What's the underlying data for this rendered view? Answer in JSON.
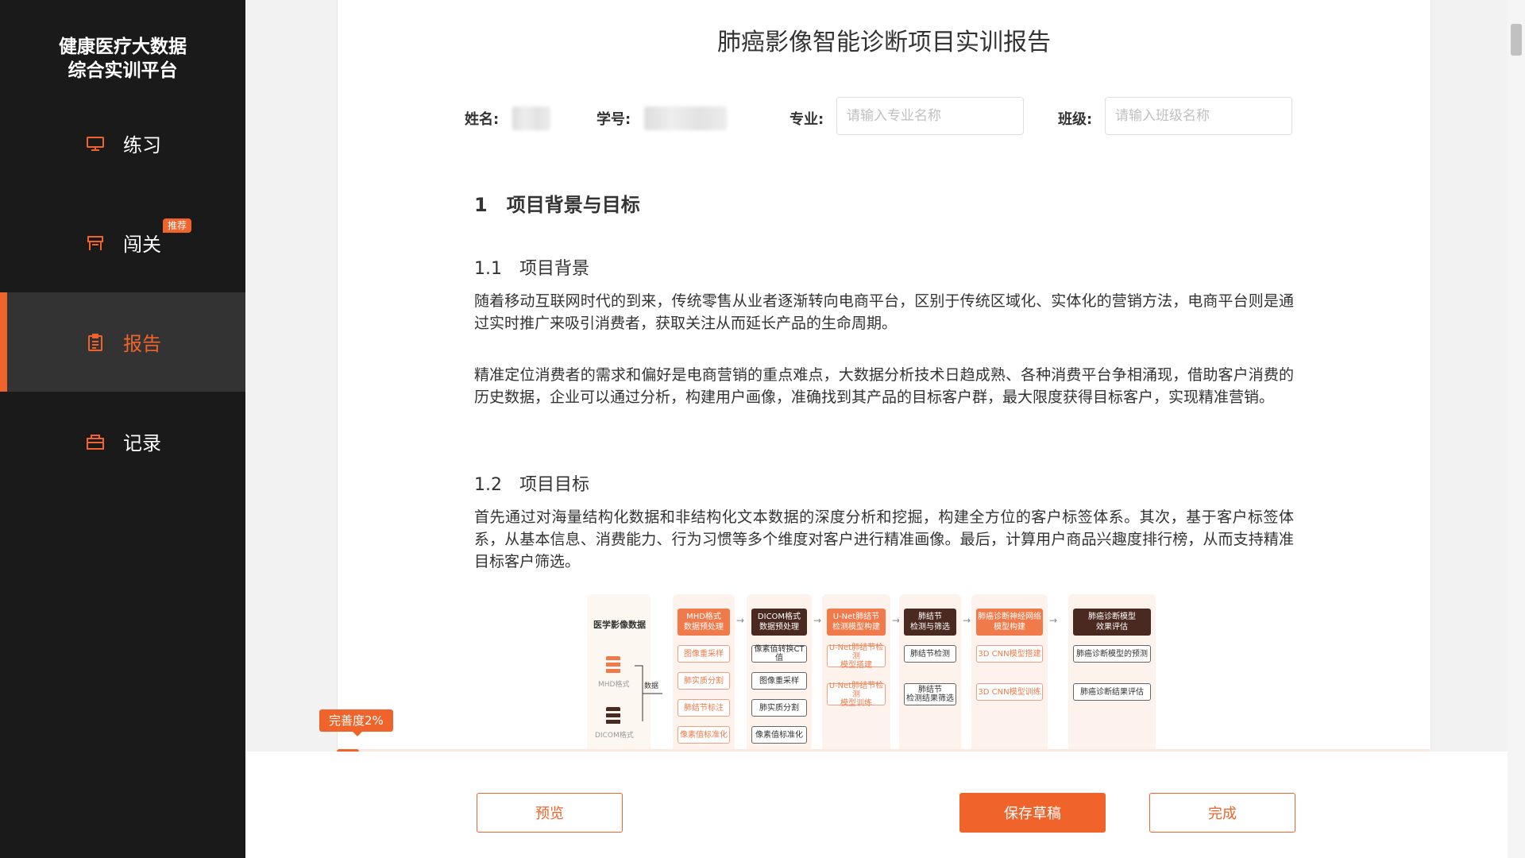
{
  "brand": {
    "line1": "健康医疗大数据",
    "line2": "综合实训平台"
  },
  "nav": [
    {
      "label": "练习",
      "icon": "monitor-icon"
    },
    {
      "label": "闯关",
      "icon": "flag-icon",
      "badge": "推荐"
    },
    {
      "label": "报告",
      "icon": "report-icon",
      "active": true
    },
    {
      "label": "记录",
      "icon": "folder-icon"
    }
  ],
  "document": {
    "title": "肺癌影像智能诊断项目实训报告",
    "fields": {
      "name_label": "姓名:",
      "id_label": "学号:",
      "major_label": "专业:",
      "major_placeholder": "请输入专业名称",
      "class_label": "班级:",
      "class_placeholder": "请输入班级名称"
    },
    "section1": "1　项目背景与目标",
    "section1_1": "1.1　项目背景",
    "para1": "随着移动互联网时代的到来，传统零售从业者逐渐转向电商平台，区别于传统区域化、实体化的营销方法，电商平台则是通过实时推广来吸引消费者，获取关注从而延长产品的生命周期。",
    "para2": "精准定位消费者的需求和偏好是电商营销的重点难点，大数据分析技术日趋成熟、各种消费平台争相涌现，借助客户消费的历史数据，企业可以通过分析，构建用户画像，准确找到其产品的目标客户群，最大限度获得目标客户，实现精准营销。",
    "section1_2": "1.2　项目目标",
    "para3": "首先通过对海量结构化数据和非结构化文本数据的深度分析和挖掘，构建全方位的客户标签体系。其次，基于客户标签体系，从基本信息、消费能力、行为习惯等多个维度对客户进行精准画像。最后，计算用户商品兴趣度排行榜，从而支持精准目标客户筛选。"
  },
  "diagram": {
    "source_title": "医学影像数据",
    "mhd_label": "MHD格式",
    "dicom_label": "DICOM格式",
    "data_label": "数据",
    "steps": [
      {
        "head": "MHD格式\n数据预处理",
        "style": "orange",
        "subs": [
          "图像重采样",
          "肺实质分割",
          "肺结节标注",
          "像素值标准化"
        ]
      },
      {
        "head": "DICOM格式\n数据预处理",
        "style": "dark",
        "subs": [
          "像素值转换CT值",
          "图像重采样",
          "肺实质分割",
          "像素值标准化"
        ]
      },
      {
        "head": "U-Net肺结节\n检测模型构建",
        "style": "orange",
        "subs": [
          "U-Net肺结节检测\n模型搭建",
          "U-Net肺结节检测\n模型训练"
        ]
      },
      {
        "head": "肺结节\n检测与筛选",
        "style": "dark",
        "subs": [
          "肺结节检测",
          "肺结节\n检测结果筛选"
        ]
      },
      {
        "head": "肺癌诊断神经网络\n模型构建",
        "style": "orange",
        "subs": [
          "3D CNN模型搭建",
          "3D CNN模型训练"
        ]
      },
      {
        "head": "肺癌诊断模型\n效果评估",
        "style": "dark",
        "subs": [
          "肺癌诊断模型的预测",
          "肺癌诊断结果评估"
        ]
      }
    ]
  },
  "progress": {
    "label": "完善度2%",
    "value": 2
  },
  "buttons": {
    "preview": "预览",
    "save_draft": "保存草稿",
    "finish": "完成"
  },
  "colors": {
    "accent": "#f0642b",
    "sidebar": "#1a1a1a"
  }
}
